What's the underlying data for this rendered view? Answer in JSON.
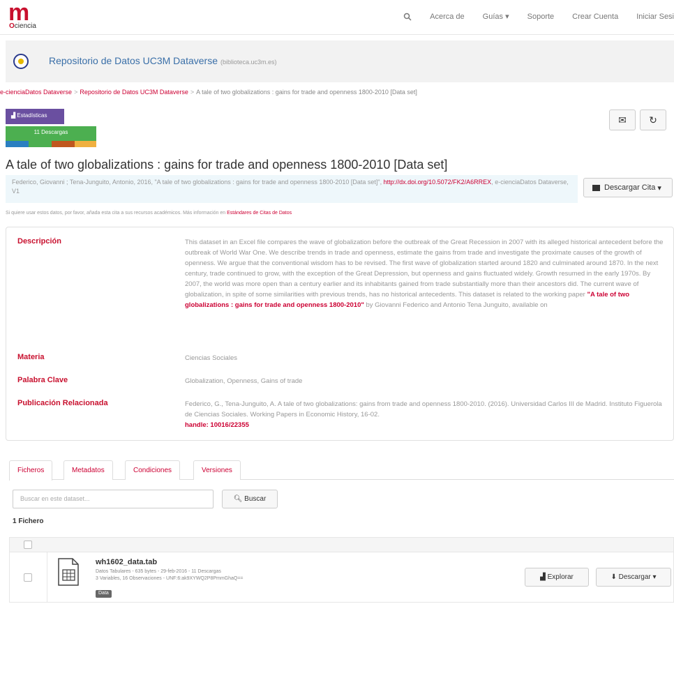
{
  "navbar": {
    "logo_mark": "m",
    "logo_text_prefix": "O",
    "logo_text": "ciencia",
    "search_icon": "search-icon",
    "items": [
      "Acerca de",
      "Guías",
      "Soporte",
      "Crear Cuenta",
      "Iniciar Sesi"
    ]
  },
  "dataverse": {
    "title": "Repositorio de Datos UC3M Dataverse",
    "affiliation": "(biblioteca.uc3m.es)"
  },
  "breadcrumb": {
    "items": [
      "e-cienciaDatos Dataverse",
      "Repositorio de Datos UC3M Dataverse",
      "A tale of two globalizations : gains for trade and openness 1800-2010 [Data set]"
    ],
    "separator": ">"
  },
  "metrics": {
    "stats_label": "Estadísticas",
    "downloads_label": "11 Descargas",
    "bar_colors": [
      "#2a7fc1",
      "#4caf50",
      "#c0571e",
      "#f0b040"
    ]
  },
  "actions": {
    "email_icon": "envelope-icon",
    "share_icon": "share-icon"
  },
  "dataset": {
    "title": "A tale of two globalizations : gains for trade and openness 1800-2010 [Data set]",
    "citation_text": "Federico, Giovanni ; Tena-Junguito, Antonio, 2016, \"A tale of two globalizations : gains for trade and openness 1800-2010 [Data set]\",",
    "citation_doi": "http://dx.doi.org/10.5072/FK2/A6RREX",
    "citation_suffix": ", e-cienciaDatos Dataverse, V1",
    "cite_button": "Descargar Cita",
    "cite_note": "Si quiere usar estos datos, por favor, añada esta cita a sus recursos académicos. Más información en",
    "cite_note_link": "Estándares de Citas de Datos"
  },
  "metadata": {
    "description_label": "Descripción",
    "description_text": "This dataset in an Excel file compares the wave of globalization before the outbreak of the Great Recession in 2007 with its alleged historical antecedent before the outbreak of World War One. We describe trends in trade and openness, estimate the gains from trade and investigate the proximate causes of the growth of openness. We argue that the conventional wisdom has to be revised. The first wave of globalization started around 1820 and culminated around 1870. In the next century, trade continued to grow, with the exception of the Great Depression, but openness and gains fluctuated widely. Growth resumed in the early 1970s. By 2007, the world was more open than a century earlier and its inhabitants gained from trade substantially more than their ancestors did. The current wave of globalization, in spite of some similarities with previous trends, has no historical antecedents. This dataset is related to the working paper",
    "description_link": "\"A tale of two globalizations : gains for trade and openness 1800-2010\"",
    "description_tail": " by Giovanni Federico and Antonio Tena Junguito, available on",
    "subject_label": "Materia",
    "subject_value": "Ciencias Sociales",
    "keyword_label": "Palabra Clave",
    "keyword_value": "Globalization, Openness, Gains of trade",
    "related_label": "Publicación Relacionada",
    "related_value": "Federico, G., Tena-Junguito, A. A tale of two globalizations: gains from trade and openness 1800-2010. (2016). Universidad Carlos III de Madrid. Instituto Figuerola de Ciencias Sociales. Working Papers in Economic History, 16-02.",
    "related_link": "handle: 10016/22355"
  },
  "tabs": [
    "Ficheros",
    "Metadatos",
    "Condiciones",
    "Versiones"
  ],
  "files": {
    "search_placeholder": "Buscar en este dataset...",
    "search_button": "Buscar",
    "count": "1 Fichero",
    "items": [
      {
        "name": "wh1602_data.tab",
        "info_line1": "Datos Tabulares - 635 bytes - 29-feb-2016 - 11 Descargas",
        "info_line2": "3 Variables, 16 Observaciones - UNF:6:ak9XYWQ2P8PmmGhaQ==",
        "tag": "Data",
        "explore_label": "Explorar",
        "download_label": "Descargar"
      }
    ]
  }
}
